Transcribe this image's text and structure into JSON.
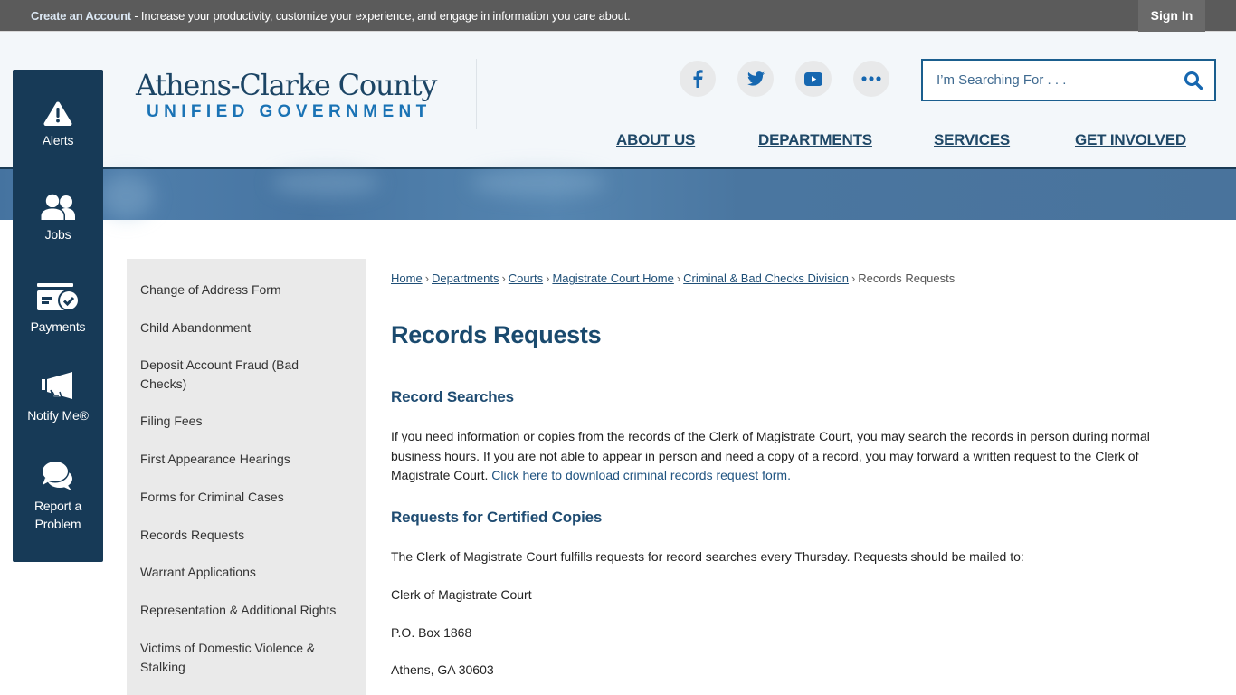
{
  "topbar": {
    "create_account": "Create an Account",
    "message": " - Increase your productivity, customize your experience, and engage in information you care about.",
    "sign_in": "Sign In"
  },
  "header": {
    "logo_title": "Athens-Clarke County",
    "logo_subtitle": "UNIFIED GOVERNMENT",
    "social": [
      {
        "name": "facebook",
        "icon": "facebook-icon"
      },
      {
        "name": "twitter",
        "icon": "twitter-icon"
      },
      {
        "name": "youtube",
        "icon": "youtube-icon"
      },
      {
        "name": "more",
        "icon": "more-icon"
      }
    ],
    "search": {
      "placeholder": "I’m Searching For . . .",
      "value": ""
    },
    "nav": [
      "ABOUT US",
      "DEPARTMENTS",
      "SERVICES",
      "GET INVOLVED"
    ]
  },
  "quick_links": [
    {
      "label": "Alerts",
      "icon": "alert-icon"
    },
    {
      "label": "Jobs",
      "icon": "users-icon"
    },
    {
      "label": "Payments",
      "icon": "payment-icon"
    },
    {
      "label": "Notify Me®",
      "icon": "megaphone-icon"
    },
    {
      "label": "Report a Problem",
      "icon": "chat-icon"
    }
  ],
  "sidenav": [
    "Change of Address Form",
    "Child Abandonment",
    "Deposit Account Fraud (Bad Checks)",
    "Filing Fees",
    "First Appearance Hearings",
    "Forms for Criminal Cases",
    "Records Requests",
    "Warrant Applications",
    "Representation & Additional Rights",
    "Victims of Domestic Violence & Stalking"
  ],
  "breadcrumb": {
    "links": [
      "Home",
      "Departments",
      "Courts",
      "Magistrate Court Home",
      "Criminal & Bad Checks Division"
    ],
    "separator": "›",
    "current": "Records Requests"
  },
  "content": {
    "title": "Records Requests",
    "section1": {
      "heading": "Record Searches",
      "text": "If you need information or copies from the records of the Clerk of Magistrate Court, you may search the records in person during normal business hours. If you are not able to appear in person and need a copy of a record, you may forward a written request to the Clerk of Magistrate Court. ",
      "link": "Click here to download criminal records request form."
    },
    "section2": {
      "heading": "Requests for Certified Copies",
      "text": "The Clerk of Magistrate Court fulfills requests for record searches every Thursday. Requests should be mailed to:",
      "address": [
        "Clerk of Magistrate Court",
        "P.O. Box 1868",
        "Athens, GA 30603"
      ]
    }
  },
  "colors": {
    "topbar": "#5b5b5b",
    "navy": "#173a57",
    "heading": "#1a4a6e",
    "accent_blue": "#1a73b5",
    "sidenav_bg": "#eaeaea"
  }
}
